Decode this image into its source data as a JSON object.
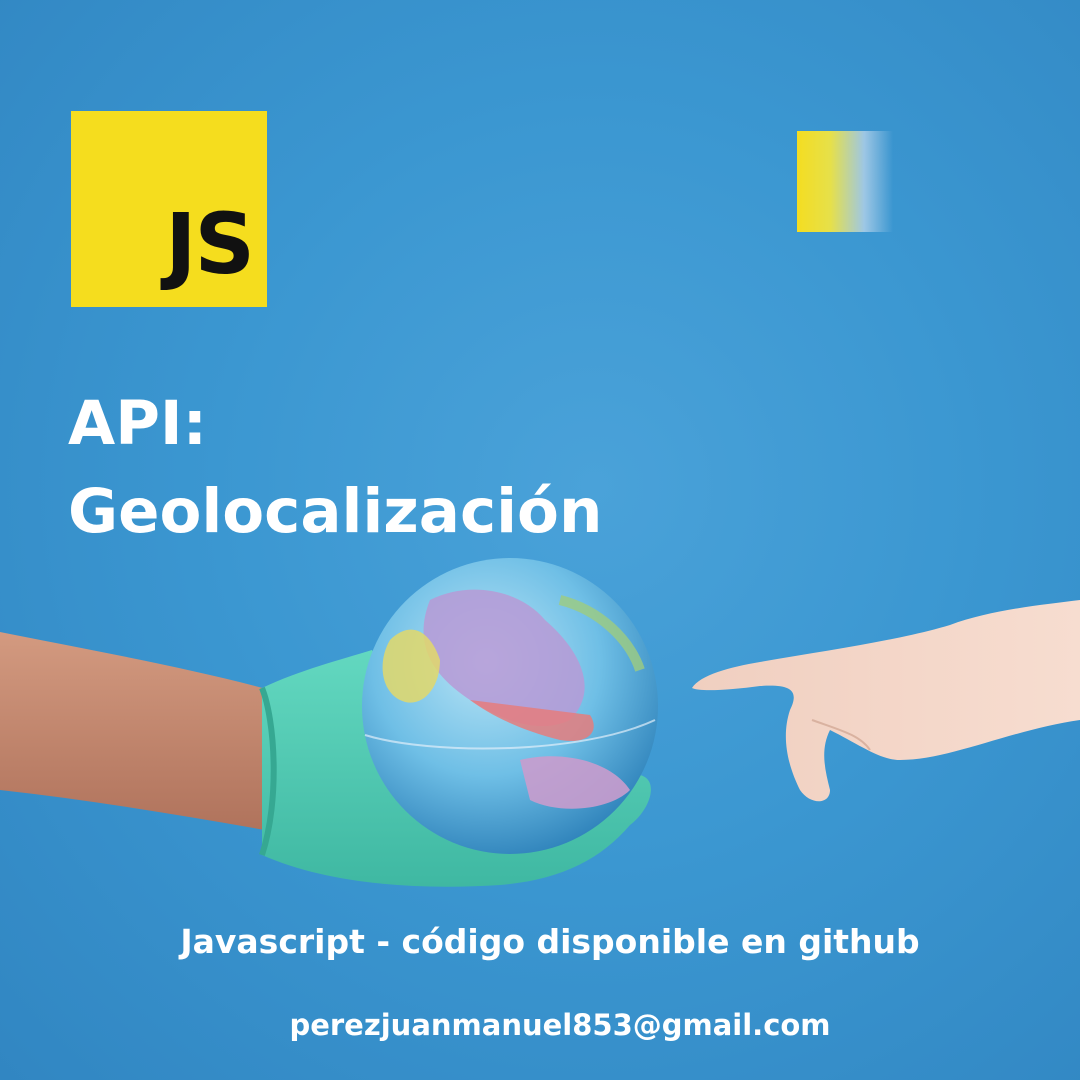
{
  "logo": {
    "text": "JS"
  },
  "title": {
    "line1": "API:",
    "line2": "Geolocalización"
  },
  "subtitle": "Javascript - código disponible en github",
  "email": "perezjuanmanuel853@gmail.com",
  "colors": {
    "background": "#3a95cf",
    "js_yellow": "#f5dd1e",
    "glove": "#55cdb4",
    "text": "#ffffff"
  },
  "illustration": {
    "description_icons": [
      "hand-with-glove-icon",
      "globe-icon",
      "pointing-hand-icon"
    ]
  }
}
